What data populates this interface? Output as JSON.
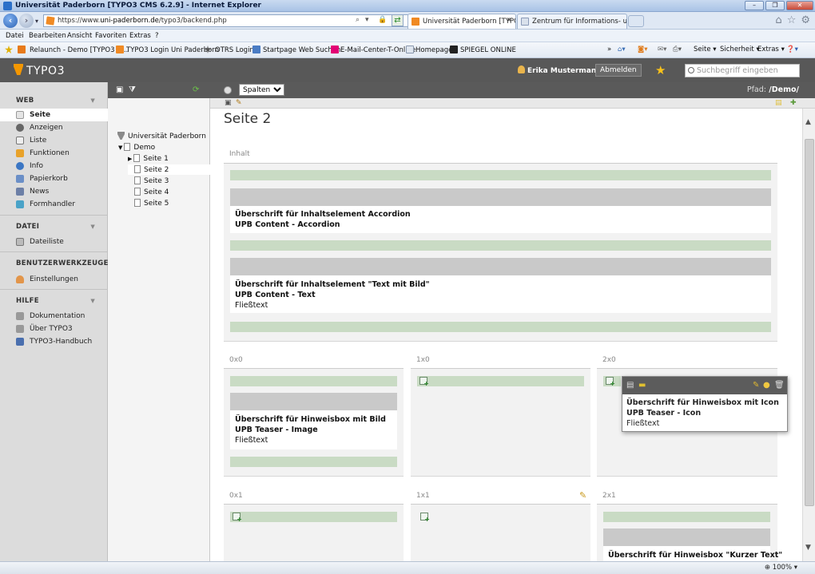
{
  "browser": {
    "window_title": "Universität Paderborn [TYPO3 CMS 6.2.9] - Internet Explorer",
    "url_prefix": "https://www.",
    "url_domain": "uni-paderborn.de",
    "url_path": "/typo3/backend.php",
    "tabs": [
      {
        "label": "Universität Paderborn [TYPO..."
      },
      {
        "label": "Zentrum für Informations- und ..."
      }
    ],
    "menu": [
      "Datei",
      "Bearbeiten",
      "Ansicht",
      "Favoriten",
      "Extras",
      "?"
    ],
    "favorites": [
      "Relaunch - Demo [TYPO3 C...",
      "TYPO3 Login Uni Paderborn",
      "OTRS  Login",
      "Startpage Web Suchen",
      "E-Mail-Center-T-Online",
      "Homepage",
      "SPIEGEL ONLINE"
    ],
    "commands": [
      "Seite",
      "Sicherheit",
      "Extras"
    ],
    "overflow": "»",
    "zoom": "100%"
  },
  "typo3": {
    "logo_text": "TYPO3",
    "user_name": "Erika Mustermann",
    "logout_label": "Abmelden",
    "search_placeholder": "Suchbegriff eingeben"
  },
  "modules": [
    {
      "section": "WEB",
      "items": [
        "Seite",
        "Anzeigen",
        "Liste",
        "Funktionen",
        "Info",
        "Papierkorb",
        "News",
        "Formhandler"
      ]
    },
    {
      "section": "DATEI",
      "items": [
        "Dateiliste"
      ]
    },
    {
      "section": "BENUTZERWERKZEUGE",
      "items": [
        "Einstellungen"
      ]
    },
    {
      "section": "HILFE",
      "items": [
        "Dokumentation",
        "Über TYPO3",
        "TYPO3-Handbuch"
      ]
    }
  ],
  "pagetree": {
    "root": "Universität Paderborn",
    "demo": "Demo",
    "pages": [
      "Seite 1",
      "Seite 2",
      "Seite 3",
      "Seite 4",
      "Seite 5"
    ]
  },
  "doc": {
    "view_select": "Spalten",
    "path_label": "Pfad:",
    "path_value": "/Demo/",
    "page_title": "Seite 2",
    "content_label": "Inhalt",
    "elements": [
      {
        "title": "Überschrift für Inhaltselement Accordion",
        "type": "UPB Content - Accordion",
        "text": ""
      },
      {
        "title": "Überschrift für Inhaltselement \"Text mit Bild\"",
        "type": "UPB Content - Text",
        "text": "Fließtext"
      }
    ],
    "grid_labels": [
      "0x0",
      "1x0",
      "2x0",
      "0x1",
      "1x1",
      "2x1"
    ],
    "grid_elements": [
      {
        "title": "Überschrift für Hinweisbox mit Bild",
        "type": "UPB Teaser - Image",
        "text": "Fließtext"
      },
      {
        "title": "Überschrift für Hinweisbox mit Icon",
        "type": "UPB Teaser - Icon",
        "text": "Fließtext"
      },
      {
        "title": "Überschrift für Hinweisbox \"Kurzer Text\"",
        "type": "",
        "text": ""
      }
    ]
  }
}
